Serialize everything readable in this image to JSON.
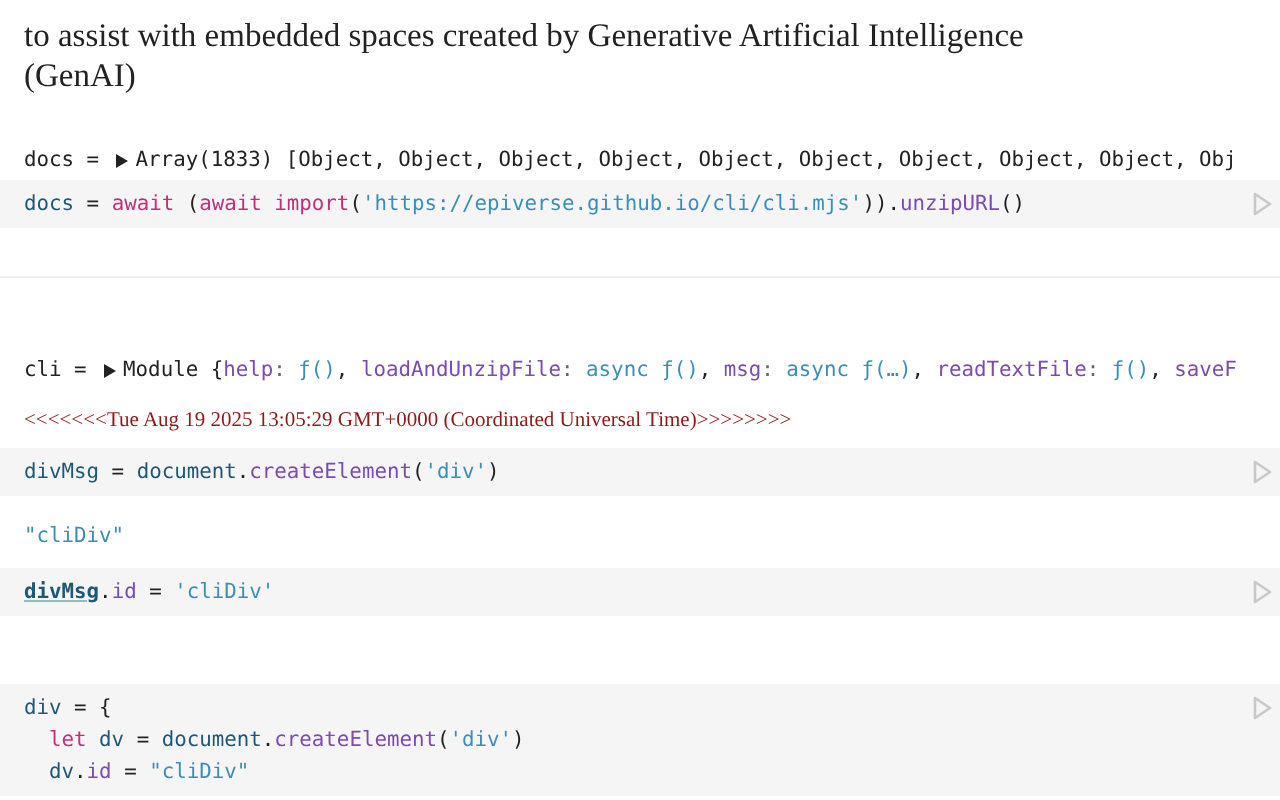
{
  "intro": {
    "lines": [
      "to assist with embedded spaces created by Generative Artificial Intelligence",
      "(GenAI)"
    ]
  },
  "cells": [
    {
      "kind": "output",
      "expanded": false,
      "name": "docs = ",
      "tokens": [
        {
          "kind": "plain",
          "text": "Array(1833) [Object, Object, Object, Object, Object, Object, Object, Object, Object, Obj"
        }
      ]
    },
    {
      "kind": "code",
      "lines": [
        [
          {
            "kind": "name",
            "text": "docs"
          },
          {
            "kind": "plain",
            "text": " = "
          },
          {
            "kind": "keyword",
            "text": "await"
          },
          {
            "kind": "plain",
            "text": " ("
          },
          {
            "kind": "keyword",
            "text": "await"
          },
          {
            "kind": "keyword",
            "text": " import"
          },
          {
            "kind": "plain",
            "text": "("
          },
          {
            "kind": "string",
            "text": "'https://epiverse.github.io/cli/cli.mjs'"
          },
          {
            "kind": "plain",
            "text": "))."
          },
          {
            "kind": "method",
            "text": "unzipURL"
          },
          {
            "kind": "plain",
            "text": "()"
          }
        ]
      ]
    },
    {
      "kind": "divider"
    },
    {
      "kind": "output",
      "expanded": false,
      "name": "cli = ",
      "tokens": [
        {
          "kind": "plain",
          "text": "Module {"
        },
        {
          "kind": "key",
          "text": "help"
        },
        {
          "kind": "punct",
          "text": ": "
        },
        {
          "kind": "fn",
          "text": "ƒ()"
        },
        {
          "kind": "plain",
          "text": ", "
        },
        {
          "kind": "key",
          "text": "loadAndUnzipFile"
        },
        {
          "kind": "punct",
          "text": ": "
        },
        {
          "kind": "fn",
          "text": "async ƒ()"
        },
        {
          "kind": "plain",
          "text": ", "
        },
        {
          "kind": "key",
          "text": "msg"
        },
        {
          "kind": "punct",
          "text": ": "
        },
        {
          "kind": "fn",
          "text": "async ƒ(…)"
        },
        {
          "kind": "plain",
          "text": ", "
        },
        {
          "kind": "key",
          "text": "readTextFile"
        },
        {
          "kind": "punct",
          "text": ": "
        },
        {
          "kind": "fn",
          "text": "ƒ()"
        },
        {
          "kind": "plain",
          "text": ", "
        },
        {
          "kind": "key",
          "text": "saveF"
        }
      ]
    },
    {
      "kind": "log",
      "text": "<<<<<<<Tue Aug 19 2025 13:05:29 GMT+0000 (Coordinated Universal Time)>>>>>>>>"
    },
    {
      "kind": "code",
      "lines": [
        [
          {
            "kind": "name",
            "text": "divMsg"
          },
          {
            "kind": "plain",
            "text": " = "
          },
          {
            "kind": "name",
            "text": "document"
          },
          {
            "kind": "plain",
            "text": "."
          },
          {
            "kind": "method",
            "text": "createElement"
          },
          {
            "kind": "plain",
            "text": "("
          },
          {
            "kind": "string",
            "text": "'div'"
          },
          {
            "kind": "plain",
            "text": ")"
          }
        ]
      ]
    },
    {
      "kind": "value",
      "text": "\"cliDiv\""
    },
    {
      "kind": "code",
      "lines": [
        [
          {
            "kind": "ref",
            "text": "divMsg"
          },
          {
            "kind": "plain",
            "text": "."
          },
          {
            "kind": "method",
            "text": "id"
          },
          {
            "kind": "plain",
            "text": " = "
          },
          {
            "kind": "string",
            "text": "'cliDiv'"
          }
        ]
      ]
    },
    {
      "kind": "spacer"
    },
    {
      "kind": "code",
      "lines": [
        [
          {
            "kind": "name",
            "text": "div"
          },
          {
            "kind": "plain",
            "text": " = {"
          }
        ],
        [
          {
            "kind": "keyword",
            "text": "  let"
          },
          {
            "kind": "name",
            "text": " dv"
          },
          {
            "kind": "plain",
            "text": " = "
          },
          {
            "kind": "name",
            "text": "document"
          },
          {
            "kind": "plain",
            "text": "."
          },
          {
            "kind": "method",
            "text": "createElement"
          },
          {
            "kind": "plain",
            "text": "("
          },
          {
            "kind": "string",
            "text": "'div'"
          },
          {
            "kind": "plain",
            "text": ")"
          }
        ],
        [
          {
            "kind": "name",
            "text": "  dv"
          },
          {
            "kind": "plain",
            "text": "."
          },
          {
            "kind": "method",
            "text": "id"
          },
          {
            "kind": "plain",
            "text": " = "
          },
          {
            "kind": "string",
            "text": "\"cliDiv\""
          }
        ]
      ]
    }
  ]
}
